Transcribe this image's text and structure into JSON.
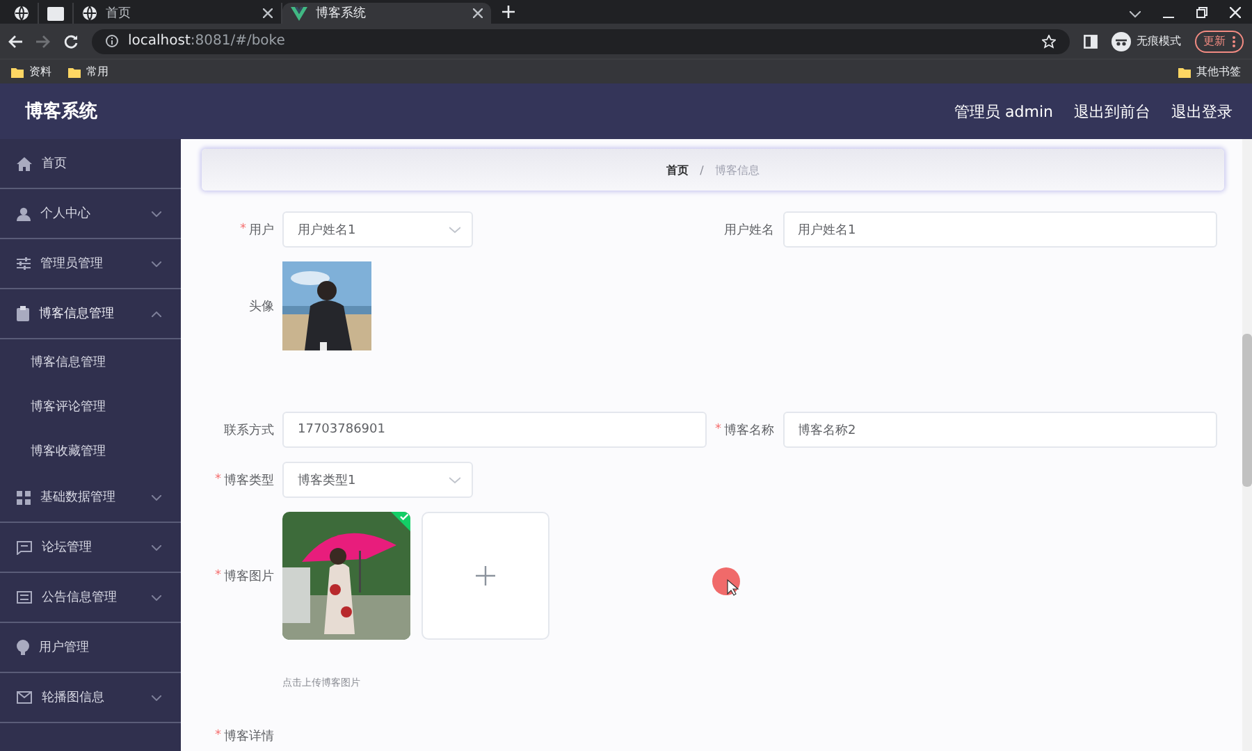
{
  "browser": {
    "tabs": [
      {
        "kind": "globe",
        "selected": false
      },
      {
        "kind": "window",
        "selected": false
      },
      {
        "kind": "globe",
        "title": "首页",
        "selected": false
      },
      {
        "kind": "vue",
        "title": "博客系统",
        "selected": true
      }
    ],
    "address": {
      "host": "localhost",
      "rest": ":8081/#/boke"
    },
    "profile": "无痕模式",
    "update": "更新",
    "bookmarks": [
      "资料",
      "常用"
    ],
    "other_bookmarks": "其他书签"
  },
  "app": {
    "title": "博客系统",
    "header_links": [
      "管理员 admin",
      "退出到前台",
      "退出登录"
    ]
  },
  "sidebar": {
    "items": [
      {
        "label": "首页"
      },
      {
        "label": "个人中心",
        "expanded": false
      },
      {
        "label": "管理员管理",
        "expanded": false
      },
      {
        "label": "博客信息管理",
        "expanded": true,
        "children": [
          {
            "label": "博客信息管理"
          },
          {
            "label": "博客评论管理"
          },
          {
            "label": "博客收藏管理"
          }
        ]
      },
      {
        "label": "基础数据管理",
        "expanded": false
      },
      {
        "label": "论坛管理",
        "expanded": false
      },
      {
        "label": "公告信息管理",
        "expanded": false
      },
      {
        "label": "用户管理"
      },
      {
        "label": "轮播图信息",
        "expanded": false
      }
    ]
  },
  "breadcrumb": {
    "items": [
      "首页",
      "博客信息"
    ],
    "separator": "/"
  },
  "form": {
    "rows": [
      [
        {
          "kind": "select",
          "required_mark": "*",
          "label": "用户",
          "value": "用户姓名1"
        },
        {
          "kind": "input",
          "label": "用户姓名",
          "value": "用户姓名1"
        }
      ],
      [
        {
          "label": "头像"
        }
      ],
      [
        {
          "kind": "input",
          "label": "联系方式",
          "value": "17703786901"
        },
        {
          "kind": "input",
          "required_mark": "*",
          "label": "博客名称",
          "value": "博客名称2"
        }
      ],
      [
        {
          "kind": "select",
          "required_mark": "*",
          "label": "博客类型",
          "value": "博客类型1"
        }
      ],
      [
        {
          "kind": "upload",
          "required_mark": "*",
          "label": "博客图片",
          "uploaded": true,
          "hint": "点击上传博客图片"
        }
      ],
      [
        {
          "kind": "editor",
          "required_mark": "*",
          "label": "博客详情"
        }
      ]
    ]
  }
}
